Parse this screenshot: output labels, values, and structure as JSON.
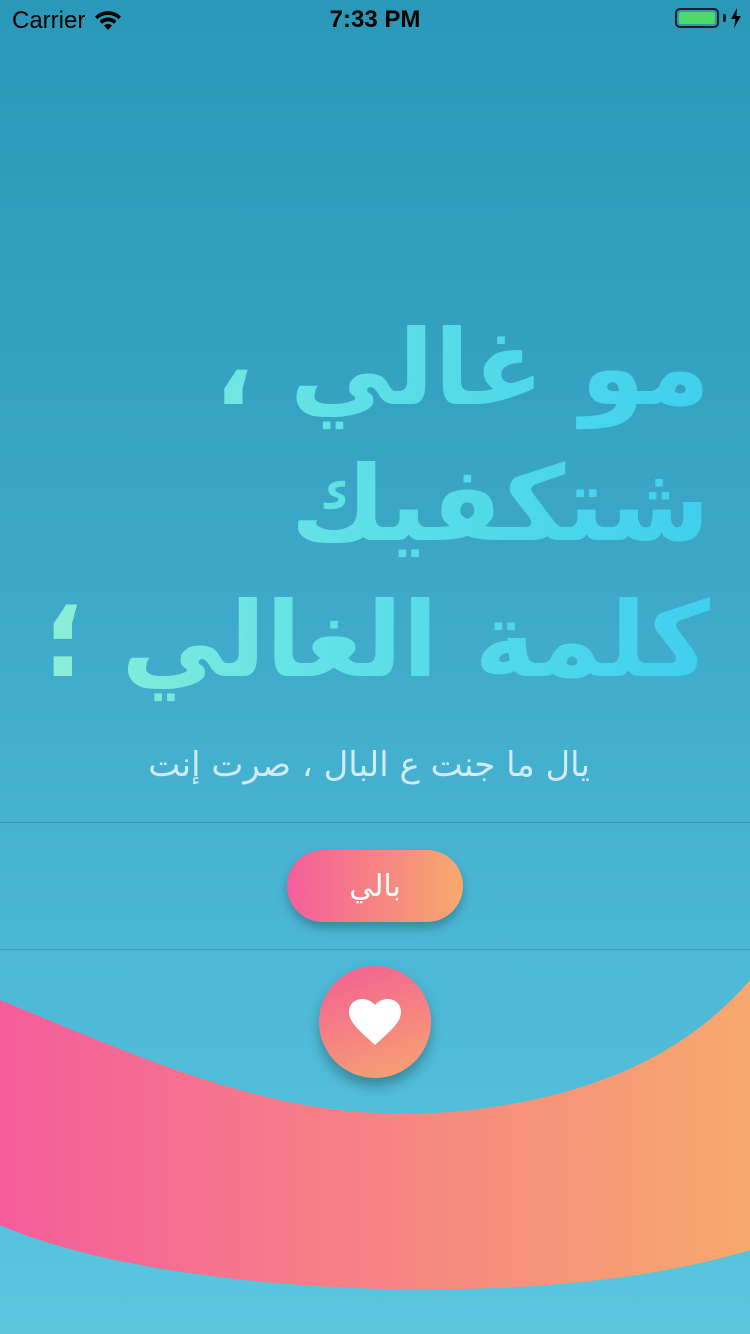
{
  "status_bar": {
    "carrier": "Carrier",
    "time": "7:33 PM",
    "battery_level": 1.0
  },
  "headline": {
    "lines": [
      "مو غالي ،",
      "شتكفيك",
      "كلمة الغالي ؛"
    ]
  },
  "subtitle": "يال ما جنت ع البال ، صرت إنت",
  "primary_button": {
    "label": "بالي"
  },
  "favorite_button": {
    "icon": "heart-icon"
  },
  "colors": {
    "background_top": "#2a98b8",
    "background_bottom": "#5bc6de",
    "headline_start": "#8ef0d6",
    "headline_end": "#3fcfee",
    "accent_pink": "#f55d9b",
    "accent_orange": "#f7a96d"
  }
}
